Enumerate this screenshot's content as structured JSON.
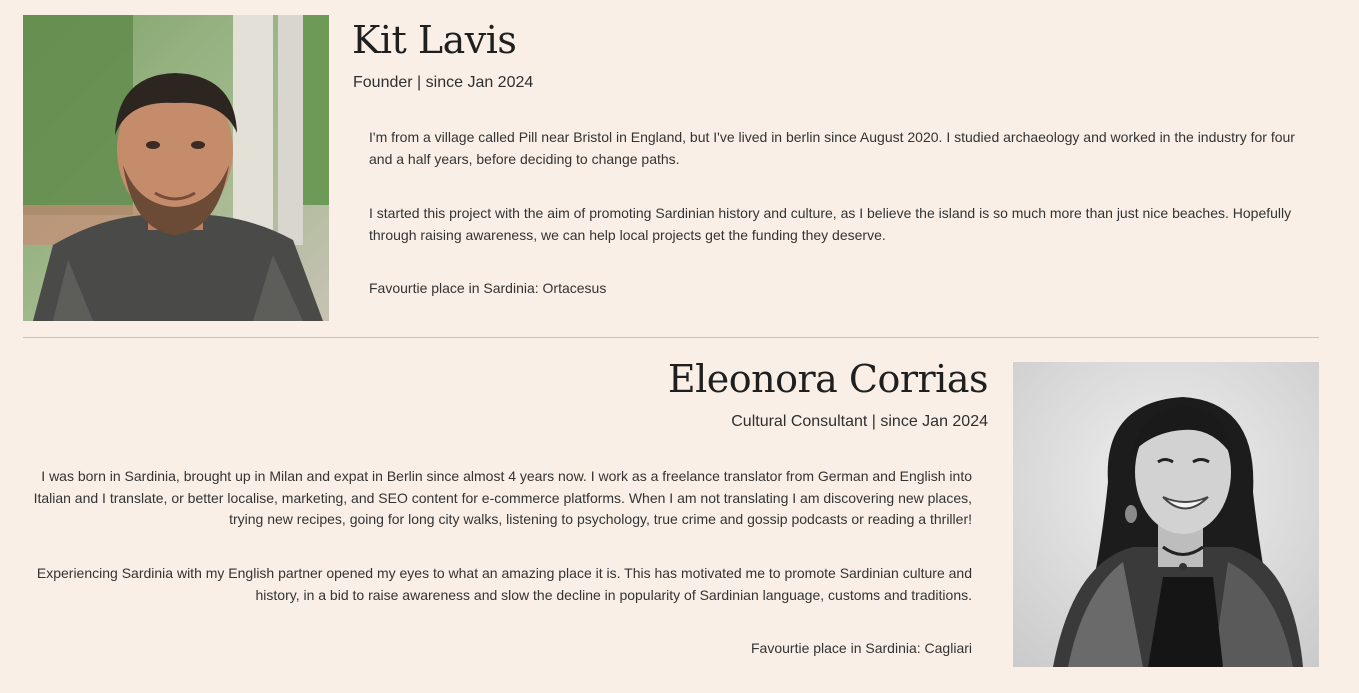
{
  "colors": {
    "background": "#f9efe6",
    "text": "#2b2b2b",
    "divider": "#c9c2bb"
  },
  "team": [
    {
      "name": "Kit Lavis",
      "role": "Founder | since Jan 2024",
      "photo_alt": "portrait photo of Kit Lavis",
      "paragraphs": [
        "I'm from a village called Pill near Bristol in England, but I've lived in berlin since August 2020. I studied archaeology and worked in the industry for four and a half years, before deciding to change paths.",
        "I started this project with the aim of promoting Sardinian history and culture, as I believe the island is so much more than just nice beaches. Hopefully through raising awareness, we can help local projects get the funding they deserve.",
        "Favourtie place in Sardinia: Ortacesus"
      ]
    },
    {
      "name": "Eleonora Corrias",
      "role": "Cultural Consultant | since Jan 2024",
      "photo_alt": "black and white portrait photo of Eleonora Corrias",
      "paragraphs": [
        "I was born in Sardinia, brought up in Milan and expat in Berlin since almost 4 years now. I work as a freelance translator from German and English into Italian and I translate, or better localise, marketing, and SEO content for e-commerce platforms. When I am not translating I am discovering new places, trying new recipes, going for long city walks, listening to psychology, true crime and gossip podcasts or reading a thriller!",
        "Experiencing Sardinia with my English partner opened my eyes to what an amazing place it is. This has motivated me to promote Sardinian culture and history, in a bid to raise awareness and slow the decline in popularity of Sardinian language, customs and traditions.",
        "Favourtie place in Sardinia: Cagliari"
      ]
    }
  ]
}
